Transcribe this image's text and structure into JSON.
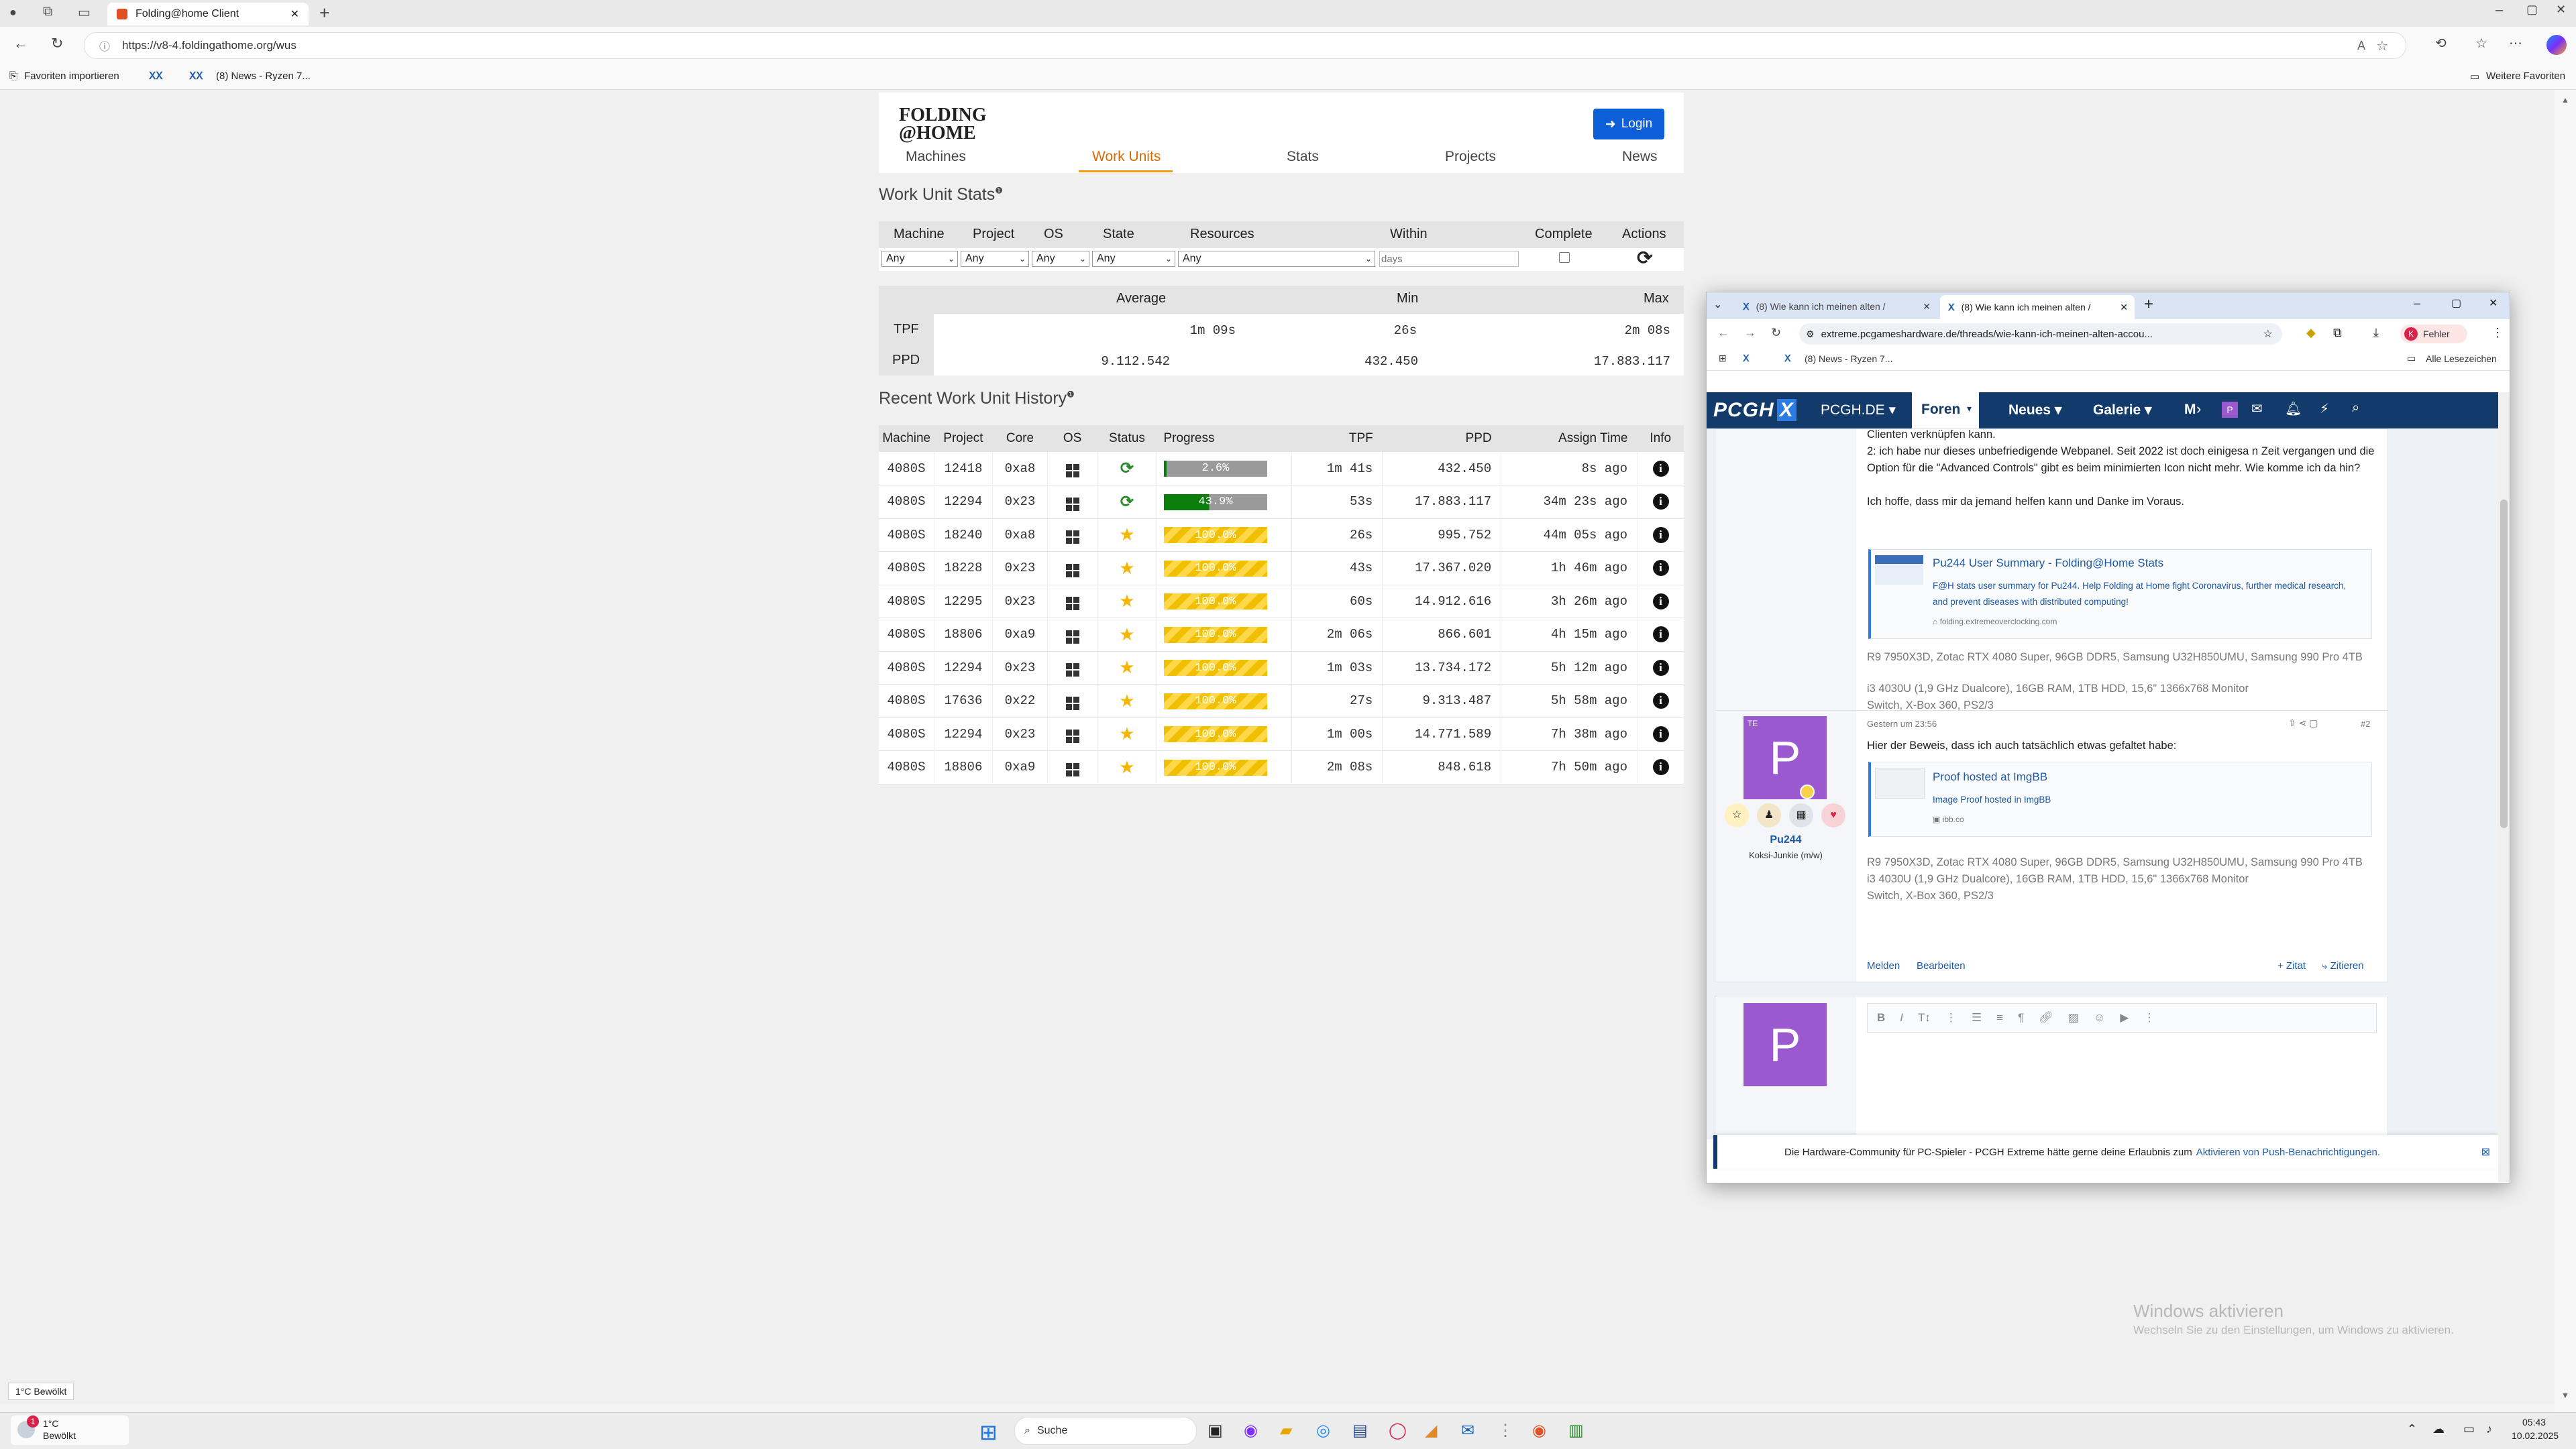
{
  "browser": {
    "tab_title": "Folding@home Client",
    "url": "https://v8-4.foldingathome.org/wus",
    "fav_import": "Favoriten importieren",
    "fav_news": "(8) News - Ryzen 7...",
    "fav_more": "Weitere Favoriten"
  },
  "fah": {
    "logo_line1": "FOLDING",
    "logo_line2": "@HOME",
    "login": "Login",
    "nav": [
      "Machines",
      "Work Units",
      "Stats",
      "Projects",
      "News"
    ],
    "stats_title": "Work Unit Stats",
    "filter_headers": [
      "Machine",
      "Project",
      "OS",
      "State",
      "Resources",
      "Within",
      "Complete",
      "Actions"
    ],
    "filter_values": [
      "Any",
      "Any",
      "Any",
      "Any",
      "Any"
    ],
    "within_placeholder": "days",
    "summary_headers": [
      "Average",
      "Min",
      "Max"
    ],
    "summary_rows": [
      {
        "label": "TPF",
        "avg": "1m 09s",
        "min": "26s",
        "max": "2m 08s"
      },
      {
        "label": "PPD",
        "avg": "9.112.542",
        "min": "432.450",
        "max": "17.883.117"
      }
    ],
    "history_title": "Recent Work Unit History",
    "history_headers": [
      "Machine",
      "Project",
      "Core",
      "OS",
      "Status",
      "Progress",
      "TPF",
      "PPD",
      "Assign Time",
      "Info"
    ],
    "history": [
      {
        "machine": "4080S",
        "project": "12418",
        "core": "0xa8",
        "status": "running",
        "progress": "2.6%",
        "tpf": "1m 41s",
        "ppd": "432.450",
        "assign": "8s ago"
      },
      {
        "machine": "4080S",
        "project": "12294",
        "core": "0x23",
        "status": "running",
        "progress": "43.9%",
        "tpf": "53s",
        "ppd": "17.883.117",
        "assign": "34m 23s ago"
      },
      {
        "machine": "4080S",
        "project": "18240",
        "core": "0xa8",
        "status": "done",
        "progress": "100.0%",
        "tpf": "26s",
        "ppd": "995.752",
        "assign": "44m 05s ago"
      },
      {
        "machine": "4080S",
        "project": "18228",
        "core": "0x23",
        "status": "done",
        "progress": "100.0%",
        "tpf": "43s",
        "ppd": "17.367.020",
        "assign": "1h 46m ago"
      },
      {
        "machine": "4080S",
        "project": "12295",
        "core": "0x23",
        "status": "done",
        "progress": "100.0%",
        "tpf": "60s",
        "ppd": "14.912.616",
        "assign": "3h 26m ago"
      },
      {
        "machine": "4080S",
        "project": "18806",
        "core": "0xa9",
        "status": "done",
        "progress": "100.0%",
        "tpf": "2m 06s",
        "ppd": "866.601",
        "assign": "4h 15m ago"
      },
      {
        "machine": "4080S",
        "project": "12294",
        "core": "0x23",
        "status": "done",
        "progress": "100.0%",
        "tpf": "1m 03s",
        "ppd": "13.734.172",
        "assign": "5h 12m ago"
      },
      {
        "machine": "4080S",
        "project": "17636",
        "core": "0x22",
        "status": "done",
        "progress": "100.0%",
        "tpf": "27s",
        "ppd": "9.313.487",
        "assign": "5h 58m ago"
      },
      {
        "machine": "4080S",
        "project": "12294",
        "core": "0x23",
        "status": "done",
        "progress": "100.0%",
        "tpf": "1m 00s",
        "ppd": "14.771.589",
        "assign": "7h 38m ago"
      },
      {
        "machine": "4080S",
        "project": "18806",
        "core": "0xa9",
        "status": "done",
        "progress": "100.0%",
        "tpf": "2m 08s",
        "ppd": "848.618",
        "assign": "7h 50m ago"
      }
    ]
  },
  "pcgh": {
    "tab1": "(8) Wie kann ich meinen alten /",
    "tab2": "(8) Wie kann ich meinen alten /",
    "url": "extreme.pcgameshardware.de/threads/wie-kann-ich-meinen-alten-accou...",
    "profile_label": "Fehler",
    "bm_news": "(8) News - Ryzen 7...",
    "bm_all": "Alle Lesezeichen",
    "nav": [
      "PCGH.DE",
      "Foren",
      "Neues",
      "Galerie",
      "M"
    ],
    "post1_line0": "Clienten verknüpfen kann.",
    "post1_line1": "2: ich habe nur dieses unbefriedigende Webpanel. Seit 2022 ist doch einigesa n Zeit vergangen und die Option für die \"Advanced Controls\" gibt es beim minimierten Icon nicht mehr. Wie komme ich da hin?",
    "post1_line2": "Ich hoffe, dass mir da jemand helfen kann und Danke im Voraus.",
    "embed1_title": "Pu244 User Summary - Folding@Home Stats",
    "embed1_desc": "F@H stats user summary for Pu244. Help Folding at Home fight Coronavirus, further medical research, and prevent diseases with distributed computing!",
    "embed1_domain": "folding.extremeoverclocking.com",
    "sig1": "R9 7950X3D, Zotac RTX 4080 Super, 96GB DDR5, Samsung U32H850UMU, Samsung 990 Pro 4TB",
    "sig2": "i3 4030U (1,9 GHz Dualcore), 16GB RAM, 1TB HDD, 15,6\" 1366x768 Monitor",
    "sig3": "Switch, X-Box 360, PS2/3",
    "report": "Melden",
    "edit": "Bearbeiten",
    "quote": "+ Zitat",
    "cite": "Zitieren",
    "post2_time": "Gestern um 23:56",
    "post2_num": "#2",
    "post2_text": "Hier der Beweis, dass ich auch tatsächlich etwas gefaltet habe:",
    "embed2_title": "Proof hosted at ImgBB",
    "embed2_desc": "Image Proof hosted in ImgBB",
    "embed2_domain": "ibb.co",
    "user_name": "Pu244",
    "user_title": "Koksi-Junkie (m/w)",
    "avatar_letter": "P",
    "notice": "Die Hardware-Community für PC-Spieler - PCGH Extreme hätte gerne deine Erlaubnis zum",
    "notice_link": "Aktivieren von Push-Benachrichtigungen."
  },
  "desktop": {
    "watermark1": "Windows aktivieren",
    "watermark2": "Wechseln Sie zu den Einstellungen, um Windows zu aktivieren.",
    "weather_tooltip": "1°C Bewölkt",
    "weather_temp": "1°C",
    "weather_desc": "Bewölkt",
    "weather_badge": "1",
    "search": "Suche",
    "time": "05:43",
    "date": "10.02.2025"
  }
}
